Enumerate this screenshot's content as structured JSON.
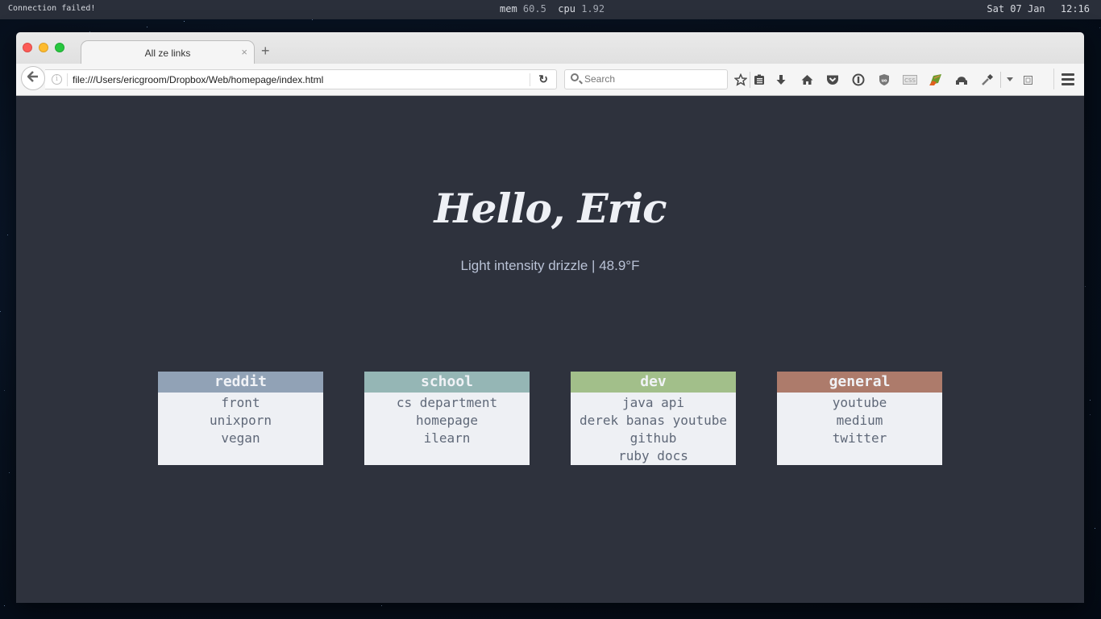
{
  "topbar": {
    "status": "Connection failed!",
    "mem_label": "mem",
    "mem_value": "60.5",
    "cpu_label": "cpu",
    "cpu_value": "1.92",
    "date": "Sat 07 Jan",
    "time": "12:16"
  },
  "browser": {
    "tab_title": "All ze links",
    "tab_close": "×",
    "new_tab": "+",
    "url": "file:///Users/ericgroom/Dropbox/Web/homepage/index.html",
    "search_placeholder": "Search",
    "toolbar_icons": [
      "bookmark-star-icon",
      "reading-list-icon",
      "download-icon",
      "home-icon",
      "pocket-icon",
      "1password-icon",
      "ublock-origin-icon",
      "css-viewer-icon",
      "firebug-icon",
      "privacy-mask-icon",
      "eyedropper-icon",
      "overflow-dropdown-icon",
      "extension-icon",
      "hamburger-menu-icon"
    ]
  },
  "page": {
    "greeting": "Hello, Eric",
    "weather": "Light intensity drizzle | 48.9°F",
    "categories": [
      {
        "title": "reddit",
        "color": "#91a2b6",
        "links": [
          "front",
          "unixporn",
          "vegan"
        ]
      },
      {
        "title": "school",
        "color": "#95b6b5",
        "links": [
          "cs department",
          "homepage",
          "ilearn"
        ]
      },
      {
        "title": "dev",
        "color": "#a2bf8a",
        "links": [
          "java api",
          "derek banas youtube",
          "github",
          "ruby docs"
        ]
      },
      {
        "title": "general",
        "color": "#ad7b6b",
        "links": [
          "youtube",
          "medium",
          "twitter"
        ]
      }
    ]
  }
}
